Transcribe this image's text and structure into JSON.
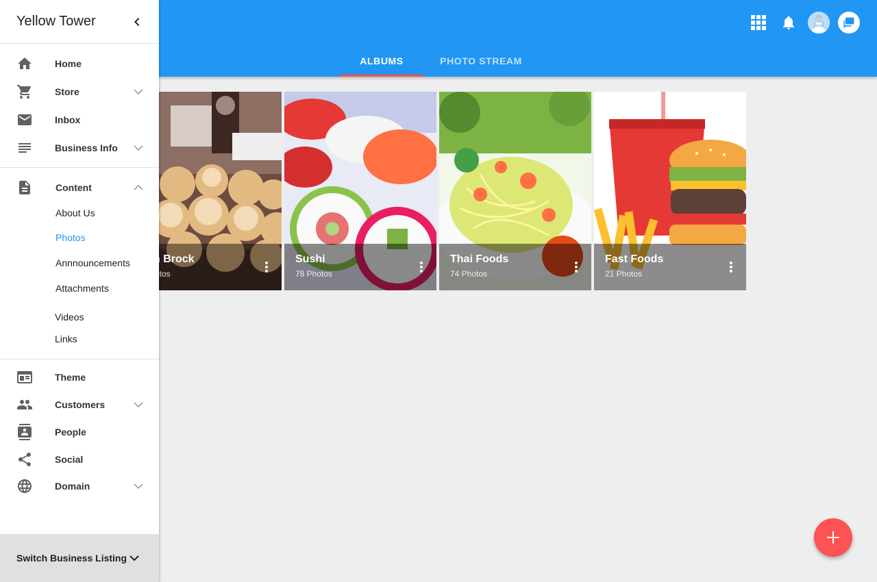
{
  "app": {
    "business_name": "Yellow Tower"
  },
  "header": {
    "tabs": [
      {
        "label": "ALBUMS",
        "active": true
      },
      {
        "label": "PHOTO STREAM",
        "active": false
      }
    ],
    "actions": [
      "apps-grid-icon",
      "notifications-bell-icon",
      "user-avatar",
      "chat-icon"
    ]
  },
  "sidebar": {
    "primary": [
      {
        "label": "Home",
        "icon": "home-icon",
        "expandable": false
      },
      {
        "label": "Store",
        "icon": "shopping-cart-icon",
        "expandable": true
      },
      {
        "label": "Inbox",
        "icon": "mail-icon",
        "expandable": false
      },
      {
        "label": "Business Info",
        "icon": "notes-icon",
        "expandable": true
      }
    ],
    "content": {
      "label": "Content",
      "icon": "document-icon",
      "expanded": true,
      "children": [
        {
          "label": "About Us",
          "active": false
        },
        {
          "label": "Photos",
          "active": true
        },
        {
          "label": "Annnouncements",
          "active": false
        },
        {
          "label": "Attachments",
          "active": false
        },
        {
          "label": "Videos",
          "active": false
        },
        {
          "label": "Links",
          "active": false
        }
      ]
    },
    "secondary": [
      {
        "label": "Theme",
        "icon": "theme-icon",
        "expandable": false
      },
      {
        "label": "Customers",
        "icon": "people-group-icon",
        "expandable": true
      },
      {
        "label": "People",
        "icon": "contact-card-icon",
        "expandable": false
      },
      {
        "label": "Social",
        "icon": "share-icon",
        "expandable": false
      },
      {
        "label": "Domain",
        "icon": "globe-icon",
        "expandable": true
      }
    ],
    "footer": {
      "label": "Switch Business Listing"
    }
  },
  "albums": [
    {
      "title": "Brioche Brock",
      "visible_title": "n Brock",
      "count": "otos",
      "image": "donuts-photo"
    },
    {
      "title": "Sushi",
      "count": "78 Photos",
      "image": "sushi-photo"
    },
    {
      "title": "Thai Foods",
      "count": "74 Photos",
      "image": "thai-salad-photo"
    },
    {
      "title": "Fast Foods",
      "count": "21 Photos",
      "image": "burger-fries-photo"
    }
  ],
  "colors": {
    "primary": "#2196f3",
    "accent": "#ff5252",
    "drawer_bg": "#ffffff",
    "content_bg": "#eeeeee"
  }
}
